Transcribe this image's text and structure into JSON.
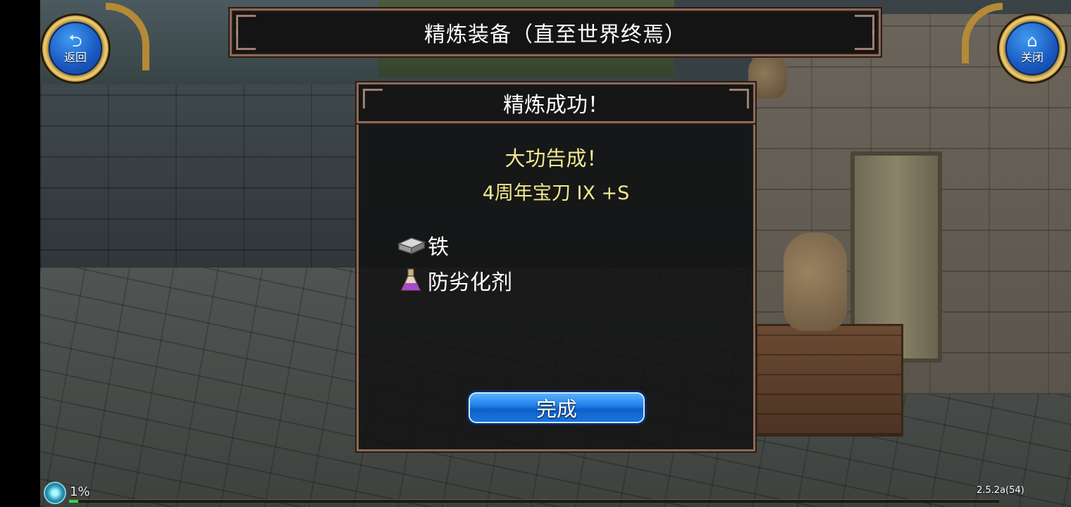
{
  "nav": {
    "back_label": "返回",
    "close_label": "关闭",
    "back_icon": "back-arrow-icon",
    "close_icon": "home-icon"
  },
  "header": {
    "title": "精炼装备（直至世界终焉）"
  },
  "dialog": {
    "title": "精炼成功！",
    "result_message": "大功告成！",
    "item_name": "4周年宝刀 IX +S",
    "materials": [
      {
        "name": "铁",
        "icon": "iron-ingot-icon"
      },
      {
        "name": "防劣化剂",
        "icon": "potion-flask-icon"
      }
    ],
    "confirm_label": "完成"
  },
  "status": {
    "progress_text": "1%",
    "progress_fraction": 0.01,
    "version": "2.5.2a(54)"
  },
  "colors": {
    "highlight_text": "#f3e88e",
    "button_blue": "#1f7ee8",
    "frame_border": "#8a6a58",
    "progress_green": "#36d23a"
  }
}
